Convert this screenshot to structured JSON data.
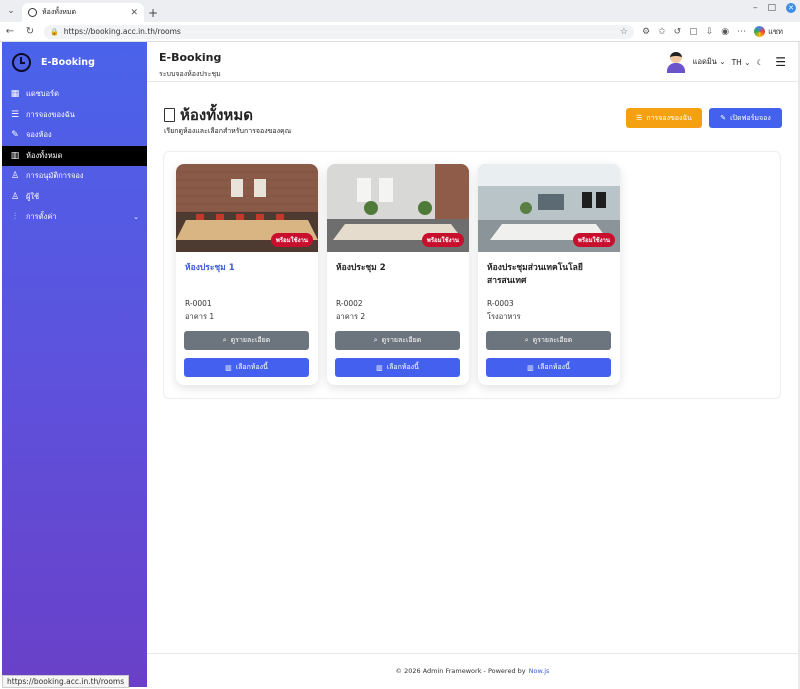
{
  "browser": {
    "tab_title": "ห้องทั้งหมด",
    "url": "https://booking.acc.in.th/rooms",
    "chat_label": "แชท",
    "status_url": "https://booking.acc.in.th/rooms"
  },
  "sidebar": {
    "brand": "E-Booking",
    "items": [
      {
        "label": "แดชบอร์ด",
        "icon": "dashboard-icon"
      },
      {
        "label": "การจองของฉัน",
        "icon": "list-icon"
      },
      {
        "label": "จองห้อง",
        "icon": "pencil-icon"
      },
      {
        "label": "ห้องทั้งหมด",
        "icon": "building-icon",
        "active": true
      },
      {
        "label": "การอนุมัติการจอง",
        "icon": "user-check-icon"
      },
      {
        "label": "ผู้ใช้",
        "icon": "users-icon"
      },
      {
        "label": "การตั้งค่า",
        "icon": "sliders-icon"
      }
    ]
  },
  "header": {
    "title": "E-Booking",
    "subtitle": "ระบบจองห้องประชุม",
    "user_name": "แอดมิน",
    "lang": "TH"
  },
  "page": {
    "title": "ห้องทั้งหมด",
    "subtitle": "เรียกดูห้องและเลือกสำหรับการจองของคุณ",
    "btn_my_bookings": "การจองของฉัน",
    "btn_open_form": "เปิดฟอร์มจอง"
  },
  "rooms": [
    {
      "name": "ห้องประชุม 1",
      "code": "R-0001",
      "building": "อาคาร 1",
      "badge": "พร้อมใช้งาน",
      "detail": "ดูรายละเอียด",
      "select": "เลือกห้องนี้"
    },
    {
      "name": "ห้องประชุม 2",
      "code": "R-0002",
      "building": "อาคาร 2",
      "badge": "พร้อมใช้งาน",
      "detail": "ดูรายละเอียด",
      "select": "เลือกห้องนี้"
    },
    {
      "name": "ห้องประชุมส่วนเทคโนโลยีสารสนเทศ",
      "code": "R-0003",
      "building": "โรงอาหาร",
      "badge": "พร้อมใช้งาน",
      "detail": "ดูรายละเอียด",
      "select": "เลือกห้องนี้"
    }
  ],
  "footer": {
    "text": "© 2026 Admin Framework - Powered by",
    "link": "Now.js"
  },
  "colors": {
    "primary": "#4361ee",
    "warning": "#f5a010",
    "badge": "#c8102e",
    "secondary": "#6c757d"
  }
}
